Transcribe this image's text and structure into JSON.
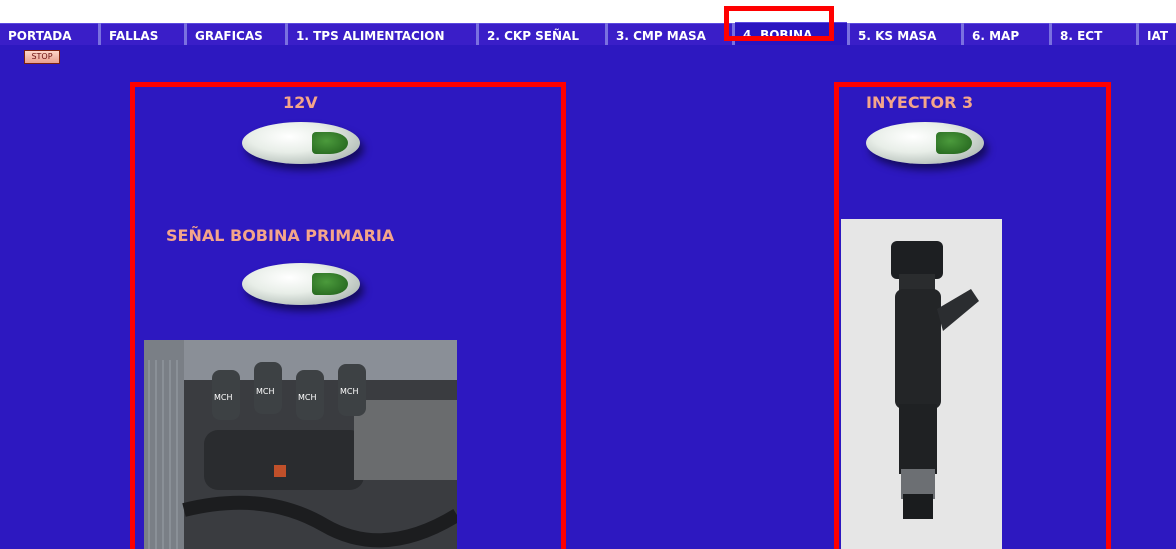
{
  "tabs": [
    {
      "label": "PORTADA"
    },
    {
      "label": "FALLAS"
    },
    {
      "label": "GRAFICAS"
    },
    {
      "label": "1. TPS ALIMENTACION"
    },
    {
      "label": "2. CKP SEÑAL"
    },
    {
      "label": "3. CMP MASA"
    },
    {
      "label": "4. BOBINA",
      "active": true
    },
    {
      "label": "5. KS MASA"
    },
    {
      "label": "6. MAP"
    },
    {
      "label": "8. ECT"
    },
    {
      "label": "IAT"
    }
  ],
  "stop_button": {
    "label": "STOP"
  },
  "left_section": {
    "indicator_1_label": "12V",
    "indicator_2_label": "SEÑAL BOBINA PRIMARIA",
    "photo_labels": [
      "MCH",
      "MCH",
      "MCH",
      "MCH"
    ]
  },
  "right_section": {
    "indicator_label": "INYECTOR 3"
  },
  "colors": {
    "panel_background": "#2d18c0",
    "highlight_frame": "#ff0000",
    "label_text": "#f4a58a",
    "led_on": "#2f7a28"
  }
}
